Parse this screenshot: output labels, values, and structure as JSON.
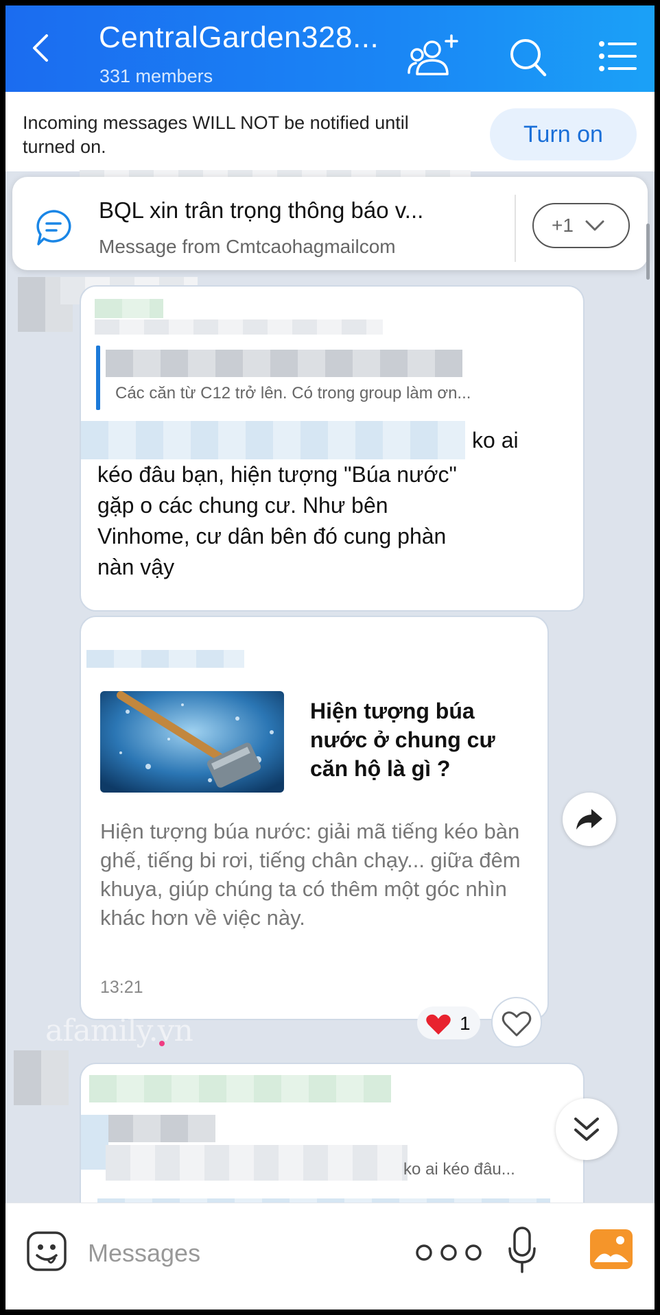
{
  "header": {
    "title": "CentralGarden328...",
    "members": "331 members"
  },
  "notice": {
    "text": "Incoming messages WILL NOT be notified until turned on.",
    "button_label": "Turn on"
  },
  "pinned": {
    "title": "BQL xin trân trọng thông báo v...",
    "subtitle": "Message from Cmtcaohagmailcom",
    "more_label": "+1"
  },
  "messages": [
    {
      "quote_text": "Các căn từ C12 trở lên. Có trong group làm ơn...",
      "text_start": "ko ai",
      "text_body": "kéo đâu bạn, hiện tượng \"Búa nước\"\ngặp o các chung cư. Như bên\nVinhome, cư dân bên đó cung phàn\nnàn vậy"
    },
    {
      "link_title": "Hiện tượng búa nước ở chung cư căn hộ là gì ?",
      "link_description": "Hiện tượng búa nước: giải mã tiếng kéo bàn ghế, tiếng bi rơi, tiếng chân chạy... giữa đêm khuya, giúp chúng ta có thêm một góc nhìn khác hơn về việc này.",
      "time": "13:21",
      "reaction_count": "1"
    },
    {
      "quote_text": "ko ai kéo đâu..."
    }
  ],
  "watermark": "afamily.vn",
  "input": {
    "placeholder": "Messages"
  },
  "colors": {
    "header_gradient_start": "#1b6cf0",
    "header_gradient_end": "#1ba1f7",
    "accent": "#1a6fd8",
    "chat_background": "#dde3ec",
    "photo_icon": "#f5952a"
  },
  "icons": [
    "back-icon",
    "add-member-icon",
    "search-icon",
    "menu-icon",
    "chat-bubble-icon",
    "chevron-down-icon",
    "share-icon",
    "heart-icon",
    "double-chevron-down-icon",
    "emoji-icon",
    "more-icon",
    "microphone-icon",
    "photo-icon"
  ]
}
